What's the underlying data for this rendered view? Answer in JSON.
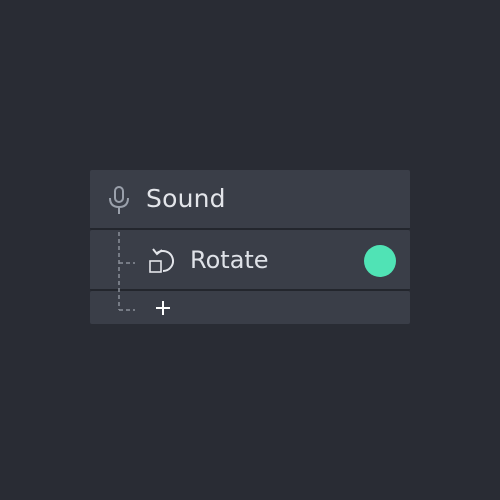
{
  "group": {
    "label": "Sound",
    "icon": "microphone-icon"
  },
  "children": [
    {
      "label": "Rotate",
      "icon": "rotate-icon",
      "status_color": "#50e3b5"
    }
  ],
  "add": {
    "icon": "plus-icon"
  },
  "colors": {
    "background": "#292c34",
    "row": "#3a3e48",
    "accent": "#50e3b5"
  }
}
